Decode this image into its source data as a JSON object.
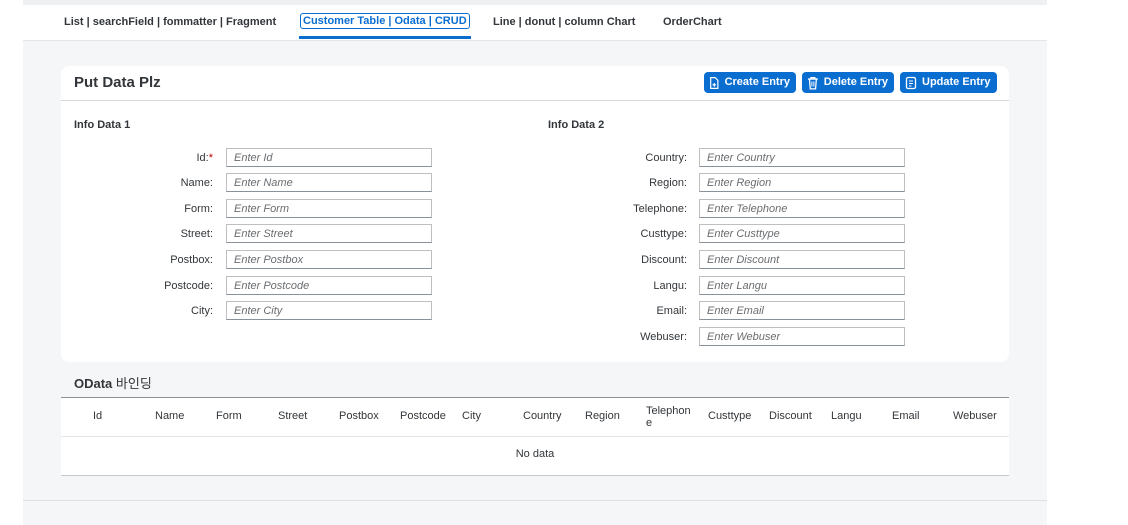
{
  "tabs": [
    {
      "label": "List | searchField | fommatter | Fragment"
    },
    {
      "label": "Customer Table | Odata | CRUD"
    },
    {
      "label": "Line | donut | column Chart"
    },
    {
      "label": "OrderChart"
    }
  ],
  "panel": {
    "title": "Put Data Plz",
    "buttons": {
      "create": "Create Entry",
      "delete": "Delete Entry",
      "update": "Update Entry"
    },
    "section1": "Info Data 1",
    "section2": "Info Data 2",
    "form1": [
      {
        "label": "Id:",
        "placeholder": "Enter Id",
        "required": true
      },
      {
        "label": "Name:",
        "placeholder": "Enter Name"
      },
      {
        "label": "Form:",
        "placeholder": "Enter Form"
      },
      {
        "label": "Street:",
        "placeholder": "Enter Street"
      },
      {
        "label": "Postbox:",
        "placeholder": "Enter Postbox"
      },
      {
        "label": "Postcode:",
        "placeholder": "Enter Postcode"
      },
      {
        "label": "City:",
        "placeholder": "Enter City"
      }
    ],
    "form2": [
      {
        "label": "Country:",
        "placeholder": "Enter Country"
      },
      {
        "label": "Region:",
        "placeholder": "Enter Region"
      },
      {
        "label": "Telephone:",
        "placeholder": "Enter Telephone"
      },
      {
        "label": "Custtype:",
        "placeholder": "Enter Custtype"
      },
      {
        "label": "Discount:",
        "placeholder": "Enter Discount"
      },
      {
        "label": "Langu:",
        "placeholder": "Enter Langu"
      },
      {
        "label": "Email:",
        "placeholder": "Enter Email"
      },
      {
        "label": "Webuser:",
        "placeholder": "Enter Webuser"
      }
    ],
    "required_mark": "*"
  },
  "table": {
    "title_en": "OData",
    "title_ko": "바인딩",
    "columns": [
      "Id",
      "Name",
      "Form",
      "Street",
      "Postbox",
      "Postcode",
      "City",
      "Country",
      "Region",
      "Telephone",
      "Custtype",
      "Discount",
      "Langu",
      "Email",
      "Webuser"
    ],
    "no_data": "No data"
  },
  "colors": {
    "accent": "#0a6ed1",
    "required": "#bb0000"
  },
  "icons": {
    "create": "add-document-icon",
    "delete": "trash-icon",
    "update": "edit-document-icon"
  }
}
